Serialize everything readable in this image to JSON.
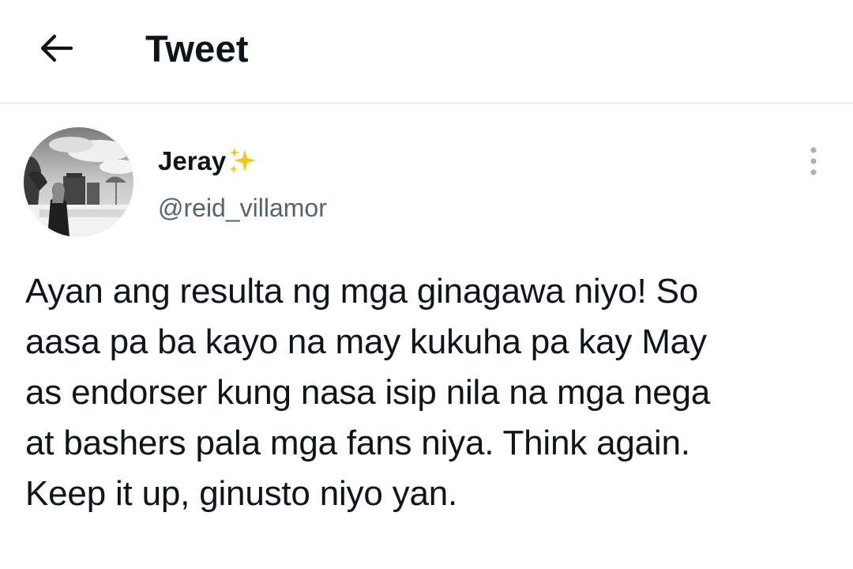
{
  "header": {
    "title": "Tweet",
    "back_icon": "arrow-left-icon"
  },
  "tweet": {
    "author": {
      "name": "Jeray",
      "name_emoji": "sparkles-icon",
      "handle": "@reid_villamor"
    },
    "more_icon": "more-vertical-icon",
    "text": "Ayan ang resulta ng mga ginagawa niyo! So\naasa pa ba kayo na may kukuha pa kay May\nas endorser kung nasa isip nila na mga nega\nat bashers pala mga fans niya. Think again.\nKeep it up, ginusto niyo yan."
  },
  "colors": {
    "text_primary": "#0f1419",
    "text_secondary": "#536471",
    "divider": "#d9dde0",
    "sparkle": "#f5c518"
  }
}
